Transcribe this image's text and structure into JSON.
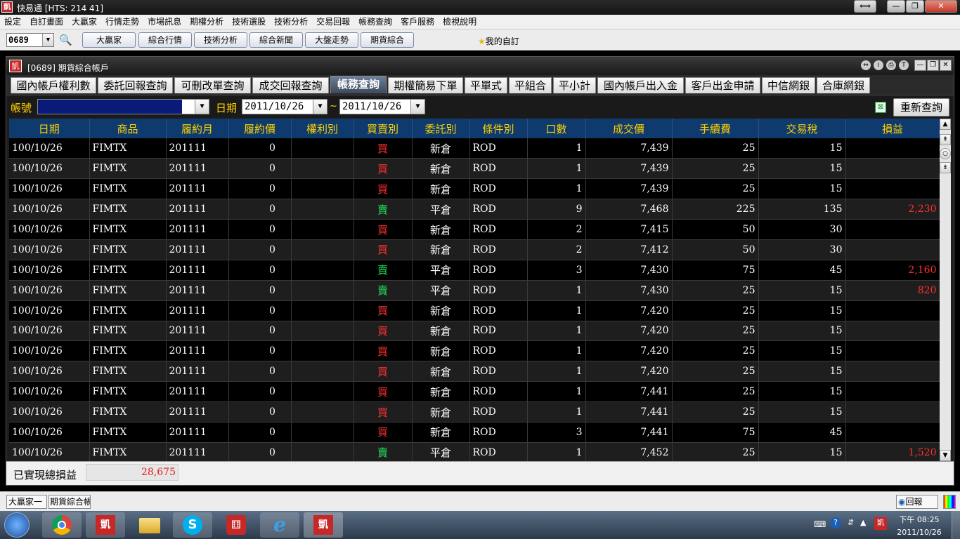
{
  "app": {
    "title": "快易通 [HTS: 214 41]",
    "window_buttons": [
      "⟺",
      "—",
      "❐",
      "✕"
    ]
  },
  "menu": [
    "設定",
    "自訂畫面",
    "大贏家",
    "行情走勢",
    "市場訊息",
    "期權分析",
    "技術選股",
    "技術分析",
    "交易回報",
    "帳務查詢",
    "客戶服務",
    "檢視說明"
  ],
  "toolbar": {
    "code_value": "0689",
    "buttons": [
      "大贏家",
      "綜合行情",
      "技術分析",
      "綜合新聞",
      "大盤走勢",
      "期貨綜合"
    ],
    "favorites_label": "我的自訂"
  },
  "child_window": {
    "title": "[0689] 期貨綜合帳戶",
    "logo": "凱"
  },
  "tabs": [
    {
      "label": "國內帳戶權利數",
      "active": false
    },
    {
      "label": "委託回報查詢",
      "active": false
    },
    {
      "label": "可刪改單查詢",
      "active": false
    },
    {
      "label": "成交回報查詢",
      "active": false
    },
    {
      "label": "帳務查詢",
      "active": true
    },
    {
      "label": "期權簡易下單",
      "active": false
    },
    {
      "label": "平單式",
      "active": false
    },
    {
      "label": "平組合",
      "active": false
    },
    {
      "label": "平小計",
      "active": false
    },
    {
      "label": "國內帳戶出入金",
      "active": false
    },
    {
      "label": "客戶出金申請",
      "active": false
    },
    {
      "label": "中信網銀",
      "active": false
    },
    {
      "label": "合庫網銀",
      "active": false
    }
  ],
  "query": {
    "account_label": "帳號",
    "account_value": "",
    "date_label": "日期",
    "date_from": "2011/10/26",
    "date_sep": "~",
    "date_to": "2011/10/26",
    "requery_button": "重新查詢"
  },
  "table": {
    "columns": [
      "日期",
      "商品",
      "履約月",
      "履約價",
      "權利別",
      "買賣別",
      "委託別",
      "條件別",
      "口數",
      "成交價",
      "手續費",
      "交易稅",
      "損益"
    ],
    "rows": [
      [
        "100/10/26",
        "FIMTX",
        "201111",
        "0",
        "",
        "買",
        "新倉",
        "ROD",
        "1",
        "7,439",
        "25",
        "15",
        ""
      ],
      [
        "100/10/26",
        "FIMTX",
        "201111",
        "0",
        "",
        "買",
        "新倉",
        "ROD",
        "1",
        "7,439",
        "25",
        "15",
        ""
      ],
      [
        "100/10/26",
        "FIMTX",
        "201111",
        "0",
        "",
        "買",
        "新倉",
        "ROD",
        "1",
        "7,439",
        "25",
        "15",
        ""
      ],
      [
        "100/10/26",
        "FIMTX",
        "201111",
        "0",
        "",
        "賣",
        "平倉",
        "ROD",
        "9",
        "7,468",
        "225",
        "135",
        "2,230"
      ],
      [
        "100/10/26",
        "FIMTX",
        "201111",
        "0",
        "",
        "買",
        "新倉",
        "ROD",
        "2",
        "7,415",
        "50",
        "30",
        ""
      ],
      [
        "100/10/26",
        "FIMTX",
        "201111",
        "0",
        "",
        "買",
        "新倉",
        "ROD",
        "2",
        "7,412",
        "50",
        "30",
        ""
      ],
      [
        "100/10/26",
        "FIMTX",
        "201111",
        "0",
        "",
        "賣",
        "平倉",
        "ROD",
        "3",
        "7,430",
        "75",
        "45",
        "2,160"
      ],
      [
        "100/10/26",
        "FIMTX",
        "201111",
        "0",
        "",
        "賣",
        "平倉",
        "ROD",
        "1",
        "7,430",
        "25",
        "15",
        "820"
      ],
      [
        "100/10/26",
        "FIMTX",
        "201111",
        "0",
        "",
        "買",
        "新倉",
        "ROD",
        "1",
        "7,420",
        "25",
        "15",
        ""
      ],
      [
        "100/10/26",
        "FIMTX",
        "201111",
        "0",
        "",
        "買",
        "新倉",
        "ROD",
        "1",
        "7,420",
        "25",
        "15",
        ""
      ],
      [
        "100/10/26",
        "FIMTX",
        "201111",
        "0",
        "",
        "買",
        "新倉",
        "ROD",
        "1",
        "7,420",
        "25",
        "15",
        ""
      ],
      [
        "100/10/26",
        "FIMTX",
        "201111",
        "0",
        "",
        "買",
        "新倉",
        "ROD",
        "1",
        "7,420",
        "25",
        "15",
        ""
      ],
      [
        "100/10/26",
        "FIMTX",
        "201111",
        "0",
        "",
        "買",
        "新倉",
        "ROD",
        "1",
        "7,441",
        "25",
        "15",
        ""
      ],
      [
        "100/10/26",
        "FIMTX",
        "201111",
        "0",
        "",
        "買",
        "新倉",
        "ROD",
        "1",
        "7,441",
        "25",
        "15",
        ""
      ],
      [
        "100/10/26",
        "FIMTX",
        "201111",
        "0",
        "",
        "買",
        "新倉",
        "ROD",
        "3",
        "7,441",
        "75",
        "45",
        ""
      ],
      [
        "100/10/26",
        "FIMTX",
        "201111",
        "0",
        "",
        "賣",
        "平倉",
        "ROD",
        "1",
        "7,452",
        "25",
        "15",
        "1,520"
      ]
    ]
  },
  "summary": {
    "label": "已實現總損益",
    "value": "28,675"
  },
  "statusbar": {
    "tasks": [
      "大贏家一",
      "期貨綜合帳戶"
    ],
    "report_label": "回報"
  },
  "taskbar": {
    "clock_time": "下午 08:25",
    "clock_date": "2011/10/26"
  },
  "colors": {
    "header_bg": "#0e3a6e",
    "header_fg": "#ffd200",
    "buy": "#ff3030",
    "sell": "#22dd55",
    "profit": "#ff3030"
  }
}
